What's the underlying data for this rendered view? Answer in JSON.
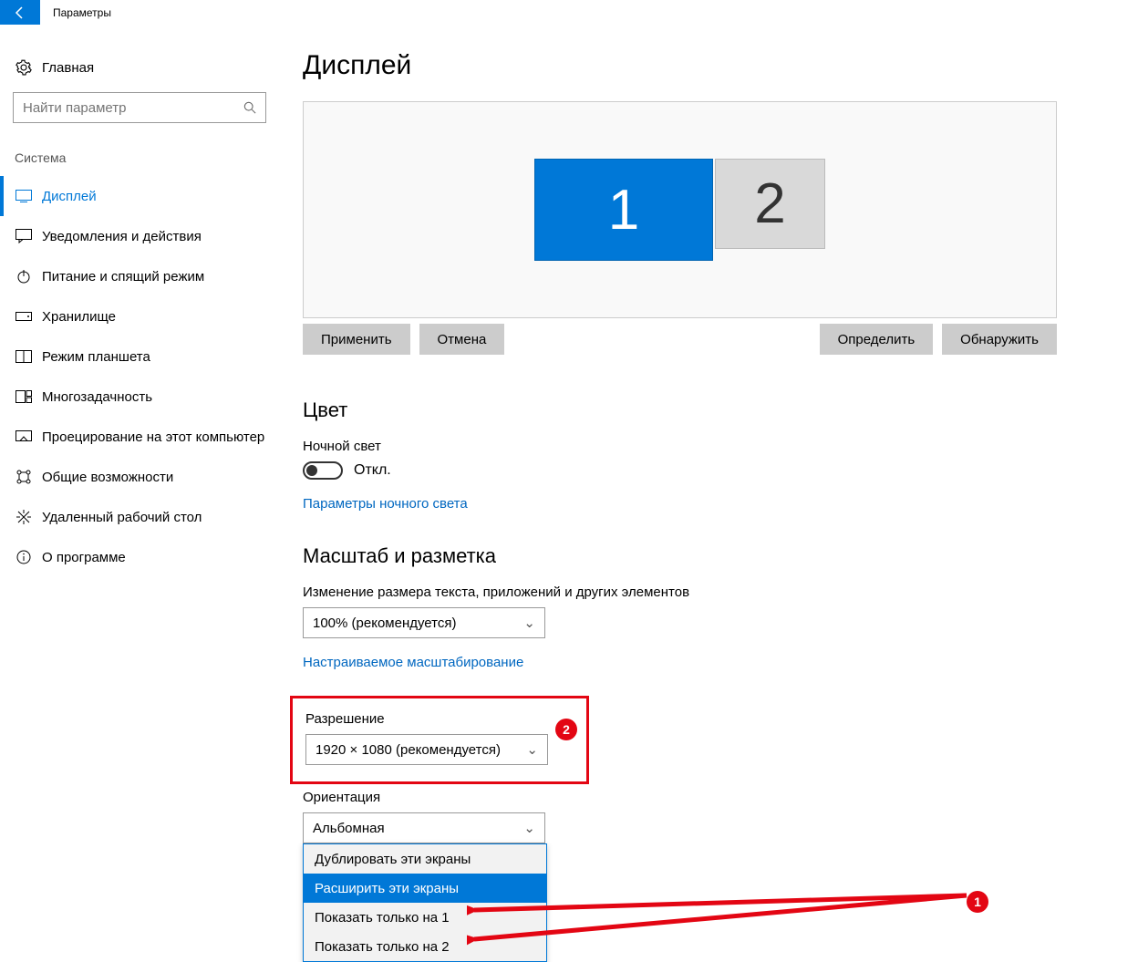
{
  "window": {
    "title": "Параметры"
  },
  "sidebar": {
    "home": "Главная",
    "search_placeholder": "Найти параметр",
    "group": "Система",
    "items": [
      {
        "label": "Дисплей"
      },
      {
        "label": "Уведомления и действия"
      },
      {
        "label": "Питание и спящий режим"
      },
      {
        "label": "Хранилище"
      },
      {
        "label": "Режим планшета"
      },
      {
        "label": "Многозадачность"
      },
      {
        "label": "Проецирование на этот компьютер"
      },
      {
        "label": "Общие возможности"
      },
      {
        "label": "Удаленный рабочий стол"
      },
      {
        "label": "О программе"
      }
    ]
  },
  "main": {
    "title": "Дисплей",
    "monitors": {
      "primary": "1",
      "secondary": "2"
    },
    "buttons": {
      "apply": "Применить",
      "cancel": "Отмена",
      "identify": "Определить",
      "detect": "Обнаружить"
    },
    "color_section": "Цвет",
    "night_light_label": "Ночной свет",
    "night_light_state": "Откл.",
    "night_light_link": "Параметры ночного света",
    "scale_section": "Масштаб и разметка",
    "scale_label": "Изменение размера текста, приложений и других элементов",
    "scale_value": "100% (рекомендуется)",
    "scale_link": "Настраиваемое масштабирование",
    "resolution_label": "Разрешение",
    "resolution_value": "1920 × 1080 (рекомендуется)",
    "orientation_label": "Ориентация",
    "orientation_value": "Альбомная",
    "multi_options": [
      "Дублировать эти экраны",
      "Расширить эти экраны",
      "Показать только на 1",
      "Показать только на 2"
    ]
  },
  "annotations": {
    "badge1": "1",
    "badge2": "2"
  }
}
